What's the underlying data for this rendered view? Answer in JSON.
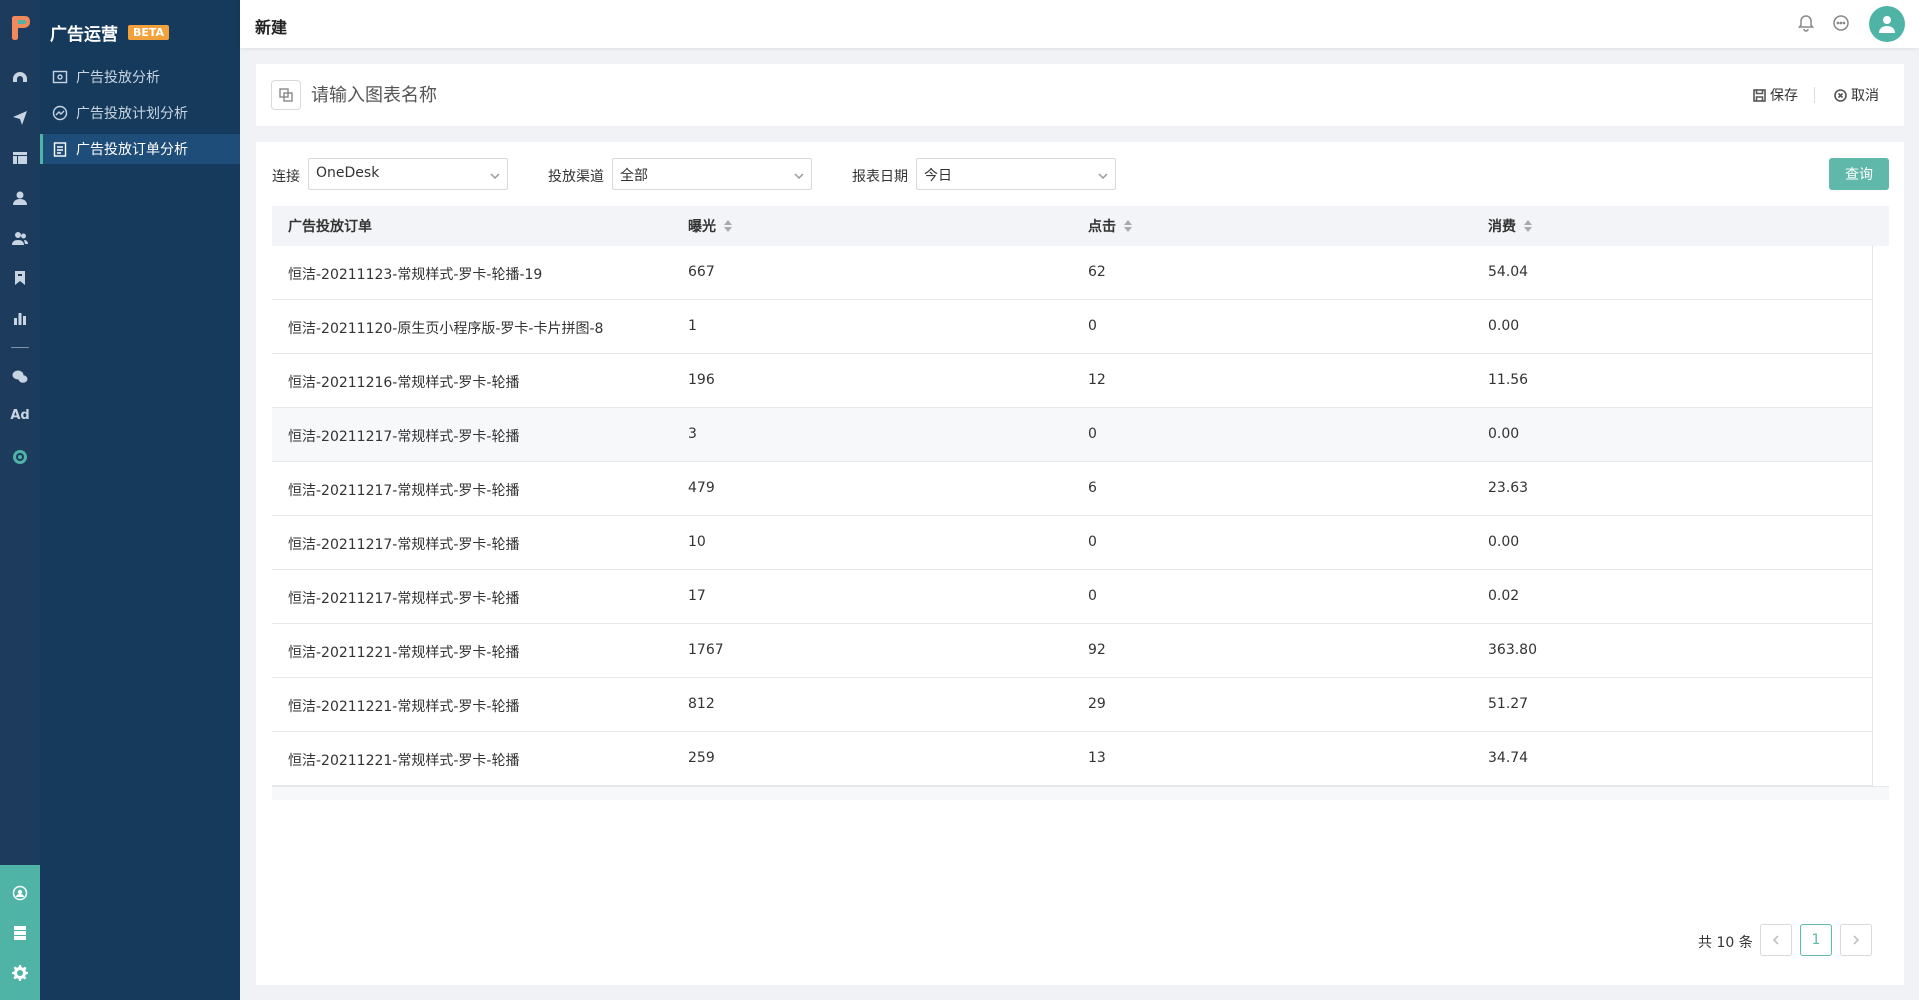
{
  "app": {
    "title": "广告运营",
    "badge": "BETA"
  },
  "nav": {
    "items": [
      {
        "label": "广告投放分析",
        "active": false
      },
      {
        "label": "广告投放计划分析",
        "active": false
      },
      {
        "label": "广告投放订单分析",
        "active": true
      }
    ]
  },
  "rail": {
    "icons": [
      "dashboard-icon",
      "send-icon",
      "table-icon",
      "user-icon",
      "users-icon",
      "bookmark-icon",
      "bar-chart-icon",
      "wechat-icon",
      "ad-icon",
      "target-icon"
    ],
    "ad_label": "Ad",
    "bottom_icons": [
      "team-icon",
      "server-icon",
      "settings-icon"
    ]
  },
  "header": {
    "title": "新建"
  },
  "chart_name": {
    "placeholder": "请输入图表名称",
    "save_label": "保存",
    "cancel_label": "取消"
  },
  "filters": {
    "connection_label": "连接",
    "connection_value": "OneDesk",
    "channel_label": "投放渠道",
    "channel_value": "全部",
    "date_label": "报表日期",
    "date_value": "今日",
    "query_label": "查询"
  },
  "table": {
    "columns": [
      "广告投放订单",
      "曝光",
      "点击",
      "消费"
    ],
    "rows": [
      [
        "恒洁-20211123-常规样式-罗卡-轮播-19",
        "667",
        "62",
        "54.04"
      ],
      [
        "恒洁-20211120-原生页小程序版-罗卡-卡片拼图-8",
        "1",
        "0",
        "0.00"
      ],
      [
        "恒洁-20211216-常规样式-罗卡-轮播",
        "196",
        "12",
        "11.56"
      ],
      [
        "恒洁-20211217-常规样式-罗卡-轮播",
        "3",
        "0",
        "0.00"
      ],
      [
        "恒洁-20211217-常规样式-罗卡-轮播",
        "479",
        "6",
        "23.63"
      ],
      [
        "恒洁-20211217-常规样式-罗卡-轮播",
        "10",
        "0",
        "0.00"
      ],
      [
        "恒洁-20211217-常规样式-罗卡-轮播",
        "17",
        "0",
        "0.02"
      ],
      [
        "恒洁-20211221-常规样式-罗卡-轮播",
        "1767",
        "92",
        "363.80"
      ],
      [
        "恒洁-20211221-常规样式-罗卡-轮播",
        "812",
        "29",
        "51.27"
      ],
      [
        "恒洁-20211221-常规样式-罗卡-轮播",
        "259",
        "13",
        "34.74"
      ]
    ]
  },
  "pagination": {
    "total": "共 10 条",
    "current": "1"
  },
  "colors": {
    "accent": "#4fb4a6",
    "sidebar": "#153a5b",
    "rail": "#1d3b5c",
    "badge": "#f3a23b"
  }
}
